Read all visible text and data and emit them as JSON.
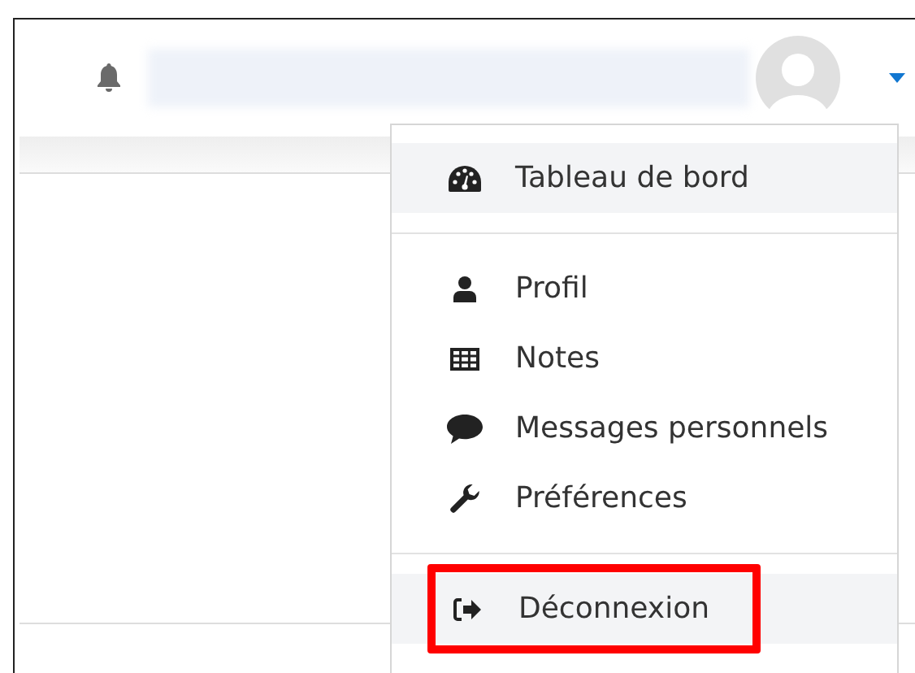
{
  "menu": {
    "groups": [
      {
        "items": [
          {
            "kind": "dashboard",
            "label": "Tableau de bord",
            "highlighted": true,
            "outlined": false
          }
        ]
      },
      {
        "items": [
          {
            "kind": "user",
            "label": "Profil",
            "highlighted": false,
            "outlined": false
          },
          {
            "kind": "table",
            "label": "Notes",
            "highlighted": false,
            "outlined": false
          },
          {
            "kind": "comment",
            "label": "Messages personnels",
            "highlighted": false,
            "outlined": false
          },
          {
            "kind": "wrench",
            "label": "Préférences",
            "highlighted": false,
            "outlined": false
          }
        ]
      },
      {
        "items": [
          {
            "kind": "logout",
            "label": "Déconnexion",
            "highlighted": true,
            "outlined": true
          }
        ]
      }
    ]
  }
}
